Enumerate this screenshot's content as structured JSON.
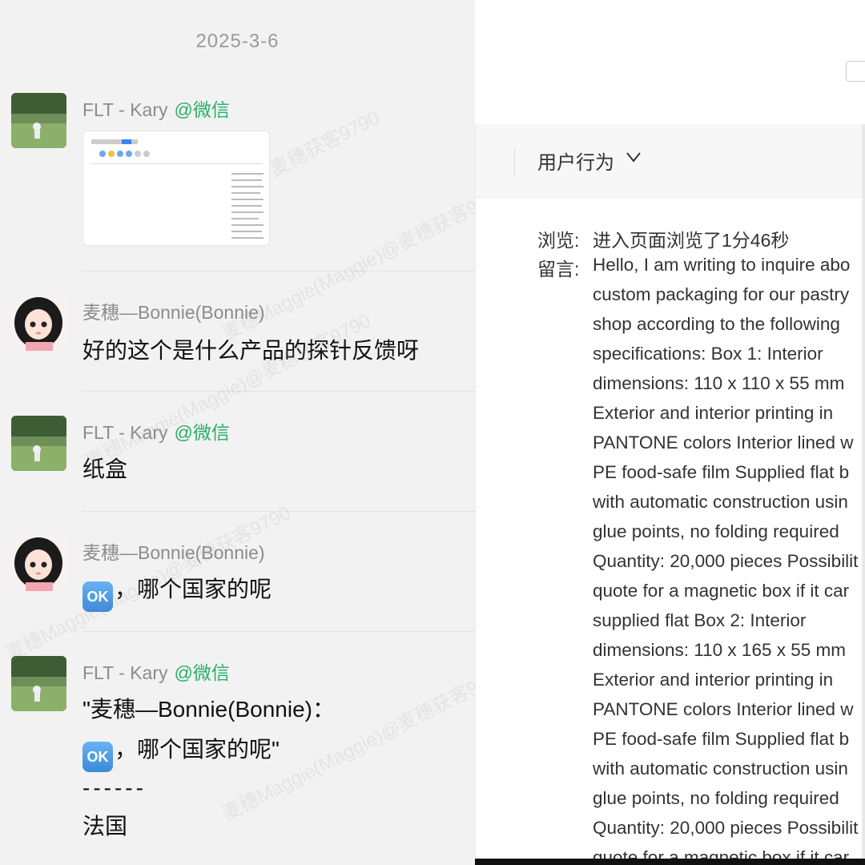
{
  "chat": {
    "date": "2025-3-6",
    "messages": [
      {
        "sender": "FLT - Kary",
        "tag": "@微信",
        "type": "image"
      },
      {
        "sender": "麦穗—Bonnie(Bonnie)",
        "text": "好的这个是什么产品的探针反馈呀"
      },
      {
        "sender": "FLT - Kary",
        "tag": "@微信",
        "text": "纸盒"
      },
      {
        "sender": "麦穗—Bonnie(Bonnie)",
        "emoji": "OK",
        "text": "，哪个国家的呢"
      },
      {
        "sender": "FLT - Kary",
        "tag": "@微信",
        "quote_line1": "\"麦穗—Bonnie(Bonnie)：",
        "quote_emoji": "OK",
        "quote_line2": "，哪个国家的呢\"",
        "separator": "------",
        "text": "法国"
      }
    ],
    "watermark": "麦穗Maggie(Maggie)@麦穗获客9790"
  },
  "panel": {
    "section_title": "用户行为",
    "browse_label": "浏览:",
    "browse_value": "进入页面浏览了1分46秒",
    "message_label": "留言:",
    "message_lines": [
      "Hello, I am writing to inquire abo",
      "custom packaging for our pastry",
      "shop according to the following",
      "specifications: Box 1: Interior",
      "dimensions: 110 x 110 x 55 mm",
      "Exterior and interior printing in",
      "PANTONE colors Interior lined w",
      "PE food-safe film Supplied flat b",
      "with automatic construction usin",
      "glue points, no folding required",
      "Quantity: 20,000 pieces Possibilit",
      "quote for a magnetic box if it car",
      "supplied flat Box 2: Interior",
      "dimensions: 110 x 165 x 55 mm",
      "Exterior and interior printing in",
      "PANTONE colors Interior lined w",
      "PE food-safe film Supplied flat b",
      "with automatic construction usin",
      "glue points, no folding required",
      "Quantity: 20,000 pieces Possibilit",
      "quote for a magnetic box if it car"
    ]
  },
  "colors": {
    "tag_green": "#2aae67",
    "chat_bg": "#f2f2f2",
    "ok_blue": "#3b8ad8"
  }
}
